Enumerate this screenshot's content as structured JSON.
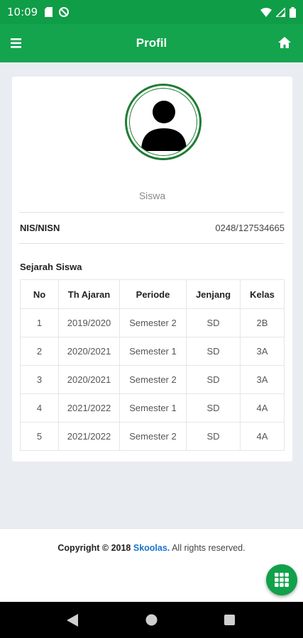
{
  "status_bar": {
    "time": "10:09",
    "icons_left": [
      "sd-card-icon",
      "sync-disabled-icon"
    ],
    "icons_right": [
      "wifi-icon",
      "cell-signal-icon",
      "battery-icon"
    ]
  },
  "app_bar": {
    "title": "Profil",
    "left_icon": "menu-icon",
    "right_icon": "home-icon",
    "color": "#14a44d"
  },
  "profile": {
    "avatar_icon": "user-avatar-icon",
    "role": "Siswa",
    "nis_label": "NIS/NISN",
    "nis_value": "0248/127534665"
  },
  "history": {
    "title": "Sejarah Siswa",
    "columns": [
      "No",
      "Th Ajaran",
      "Periode",
      "Jenjang",
      "Kelas"
    ],
    "rows": [
      [
        "1",
        "2019/2020",
        "Semester 2",
        "SD",
        "2B"
      ],
      [
        "2",
        "2020/2021",
        "Semester 1",
        "SD",
        "3A"
      ],
      [
        "3",
        "2020/2021",
        "Semester 2",
        "SD",
        "3A"
      ],
      [
        "4",
        "2021/2022",
        "Semester 1",
        "SD",
        "4A"
      ],
      [
        "5",
        "2021/2022",
        "Semester 2",
        "SD",
        "4A"
      ]
    ]
  },
  "footer": {
    "prefix": "Copyright © 2018",
    "brand": "Skoolas.",
    "suffix": "All rights reserved.",
    "brand_color": "#1a73c9"
  },
  "fab": {
    "icon": "grid-apps-icon"
  },
  "nav_bar": {
    "icons": [
      "back-icon",
      "home-circle-icon",
      "recents-icon"
    ]
  }
}
